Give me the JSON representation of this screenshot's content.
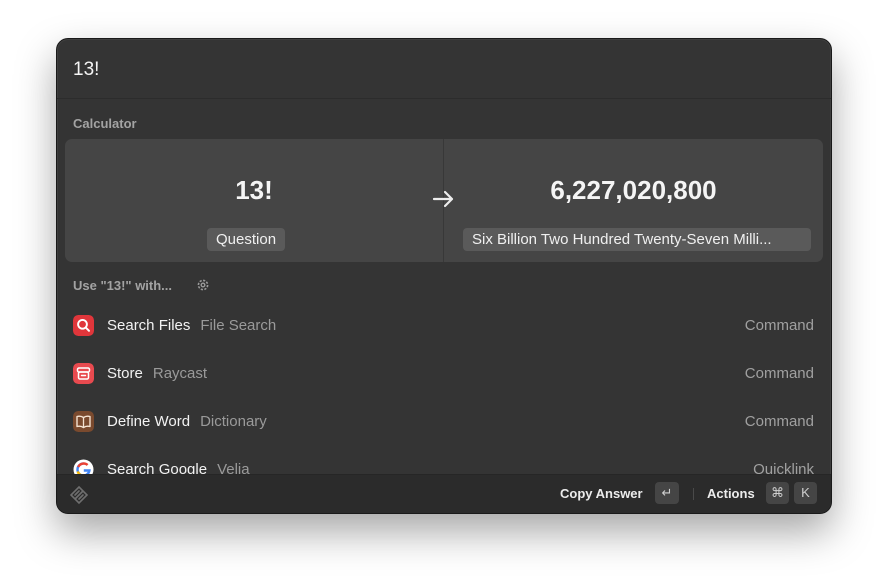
{
  "search": {
    "query": "13!"
  },
  "calculator": {
    "section_label": "Calculator",
    "question": "13!",
    "answer": "6,227,020,800",
    "question_label": "Question",
    "answer_words": "Six Billion Two Hundred Twenty-Seven Milli..."
  },
  "use_with": {
    "label": "Use \"13!\" with...",
    "icon": "gear-icon"
  },
  "items": [
    {
      "title": "Search Files",
      "subtitle": "File Search",
      "kind": "Command",
      "icon": "search-icon",
      "color": "#e0363b"
    },
    {
      "title": "Store",
      "subtitle": "Raycast",
      "kind": "Command",
      "icon": "store-icon",
      "color": "#e84a4f"
    },
    {
      "title": "Define Word",
      "subtitle": "Dictionary",
      "kind": "Command",
      "icon": "book-icon",
      "color": "#7a4a2e"
    },
    {
      "title": "Search Google",
      "subtitle": "Velja",
      "kind": "Quicklink",
      "icon": "google-icon",
      "color": "#ffffff"
    }
  ],
  "footer": {
    "logo_icon": "raycast-logo-icon",
    "primary_action": "Copy Answer",
    "primary_key": "↵",
    "actions_label": "Actions",
    "actions_keys": [
      "⌘",
      "K"
    ]
  }
}
